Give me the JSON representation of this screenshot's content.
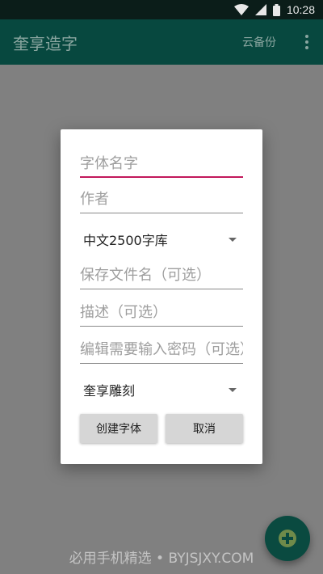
{
  "status_bar": {
    "time": "10:28",
    "icons": [
      "wifi-icon",
      "signal-icon",
      "battery-icon"
    ]
  },
  "app_bar": {
    "title": "奎享造字",
    "cloud_backup": "云备份",
    "overflow_icon": "more-vert-icon"
  },
  "dialog": {
    "font_name_placeholder": "字体名字",
    "author_placeholder": "作者",
    "charset_selected": "中文2500字库",
    "filename_placeholder": "保存文件名（可选）",
    "description_placeholder": "描述（可选）",
    "password_placeholder": "编辑需要输入密码（可选）",
    "style_selected": "奎享雕刻",
    "create_label": "创建字体",
    "cancel_label": "取消"
  },
  "fab": {
    "icon": "add-icon"
  },
  "watermark": "必用手机精选 • BYJSJXY.COM",
  "colors": {
    "status_bar": "#0b1d19",
    "app_bar": "#07483f",
    "accent": "#c2185b",
    "scrim": "#808080"
  }
}
